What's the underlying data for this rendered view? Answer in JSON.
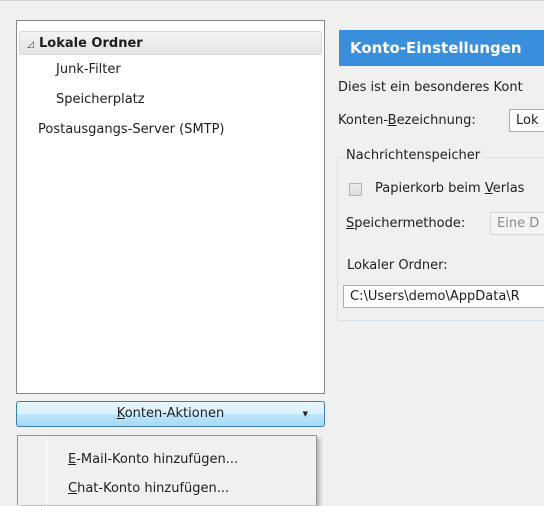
{
  "tree": {
    "items": [
      {
        "label": "Lokale Ordner",
        "toggle_icon": "◿"
      },
      {
        "label": "Junk-Filter"
      },
      {
        "label": "Speicherplatz"
      },
      {
        "label": "Postausgangs-Server (SMTP)"
      }
    ]
  },
  "settings": {
    "header": "Konto-Einstellungen",
    "description": "Dies ist ein besonderes Kont",
    "account_name_label": {
      "prefix": "Konten-",
      "accel": "B",
      "suffix": "ezeichnung:"
    },
    "account_name_value": "Lok",
    "message_store": {
      "legend": "Nachrichtenspeicher",
      "empty_trash": {
        "prefix": "Papierkorb beim ",
        "accel": "V",
        "suffix": "erlas",
        "checked": false
      },
      "store_type": {
        "accel": "S",
        "suffix": "peichermethode:",
        "value": "Eine D"
      },
      "local_dir_label": "Lokaler Ordner:",
      "local_dir_value": "C:\\Users\\demo\\AppData\\R"
    }
  },
  "actions": {
    "button": {
      "accel": "K",
      "suffix": "onten-Aktionen",
      "chevron_icon": "▼"
    },
    "menu": [
      {
        "accel": "E",
        "suffix": "-Mail-Konto hinzufügen..."
      },
      {
        "accel": "C",
        "suffix": "hat-Konto hinzufügen..."
      }
    ]
  },
  "colors": {
    "header_bg": "#3a8fdd",
    "header_fg": "#ffffff",
    "button_border": "#3c7fb1"
  }
}
